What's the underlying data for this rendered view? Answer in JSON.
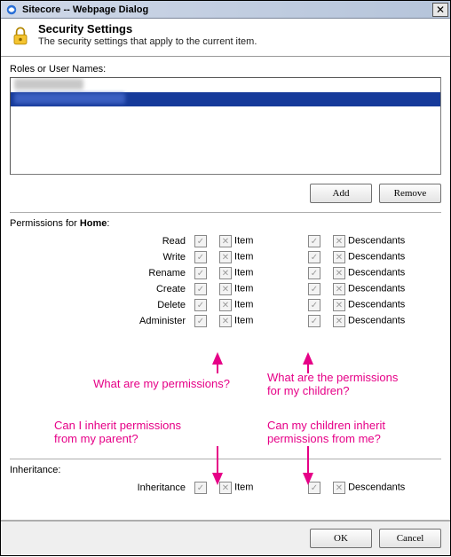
{
  "window": {
    "title": "Sitecore -- Webpage Dialog",
    "close_glyph": "✕"
  },
  "header": {
    "title": "Security Settings",
    "subtitle": "The security settings that apply to the current item."
  },
  "roles": {
    "label": "Roles or User Names:",
    "items": [
      {
        "text": "██████████",
        "selected": false
      },
      {
        "text": "████████████████",
        "selected": true
      }
    ],
    "add_label": "Add",
    "remove_label": "Remove"
  },
  "permissions": {
    "label_prefix": "Permissions for ",
    "target": "Home",
    "label_suffix": ":",
    "item_col": "Item",
    "desc_col": "Descendants",
    "rows": [
      {
        "name": "Read"
      },
      {
        "name": "Write"
      },
      {
        "name": "Rename"
      },
      {
        "name": "Create"
      },
      {
        "name": "Delete"
      },
      {
        "name": "Administer"
      }
    ]
  },
  "inheritance": {
    "section_label": "Inheritance:",
    "row_label": "Inheritance",
    "item_col": "Item",
    "desc_col": "Descendants"
  },
  "footer": {
    "ok": "OK",
    "cancel": "Cancel"
  },
  "annotations": {
    "a1": "What are my permissions?",
    "a2": "What are the permissions\nfor my children?",
    "a3": "Can I inherit permissions\nfrom my parent?",
    "a4": "Can my children inherit\npermissions from me?"
  },
  "glyphs": {
    "check": "✓",
    "x": "✕"
  }
}
